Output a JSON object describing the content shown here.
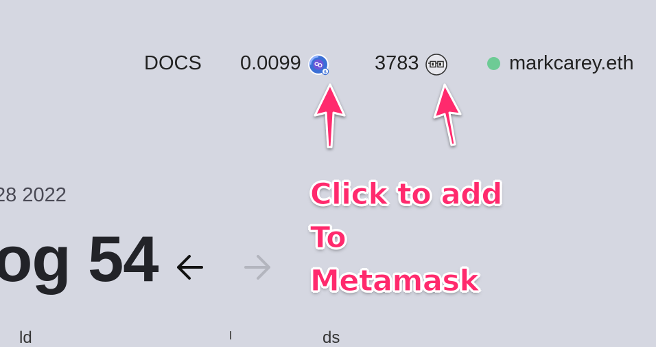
{
  "nav": {
    "docs_label": "DOCS",
    "eth_balance": "0.0099",
    "noun_balance": "3783",
    "account": "markcarey.eth",
    "eth_icon": "eth-token-icon",
    "noun_icon": "noggles-token-icon",
    "status_color": "#6dcb95"
  },
  "annotation": {
    "line1": "Click to add",
    "line2": "To",
    "line3": "Metamask",
    "color": "#ff2a6d"
  },
  "auction": {
    "date": "28 2022",
    "title": "og 54",
    "prev_icon": "arrow-left-icon",
    "next_icon": "arrow-right-icon"
  },
  "bottom": {
    "left_text": "ld",
    "right_text": "ds"
  }
}
